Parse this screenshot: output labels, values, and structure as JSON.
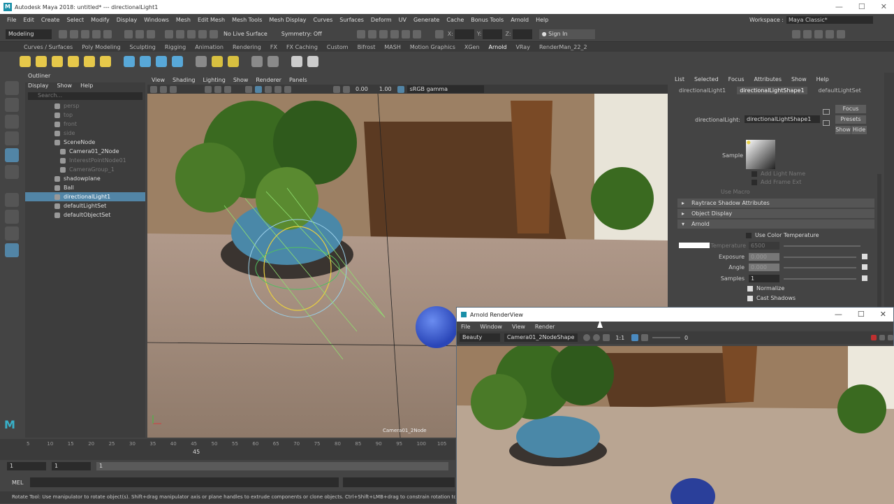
{
  "window": {
    "title": "Autodesk Maya 2018: untitled*   ---   directionalLight1",
    "logo": "M",
    "controls": [
      "—",
      "☐",
      "✕"
    ]
  },
  "menubar": {
    "items": [
      "File",
      "Edit",
      "Create",
      "Select",
      "Modify",
      "Display",
      "Windows",
      "Mesh",
      "Edit Mesh",
      "Mesh Tools",
      "Mesh Display",
      "Curves",
      "Surfaces",
      "Deform",
      "UV",
      "Generate",
      "Cache",
      "Bonus Tools",
      "Arnold",
      "Help"
    ],
    "workspace_label": "Workspace :",
    "workspace_value": "Maya Classic*"
  },
  "statusline": {
    "mode": "Modeling",
    "live_surface": "No Live Surface",
    "symmetry": "Symmetry: Off",
    "x": "X:",
    "y": "Y:",
    "z": "Z:",
    "sign_in": "Sign In"
  },
  "shelf_tabs": [
    "Curves / Surfaces",
    "Poly Modeling",
    "Sculpting",
    "Rigging",
    "Animation",
    "Rendering",
    "FX",
    "FX Caching",
    "Custom",
    "Bifrost",
    "MASH",
    "Motion Graphics",
    "XGen",
    "Arnold",
    "VRay",
    "RenderMan_22_2"
  ],
  "shelf_active": "Arnold",
  "outliner": {
    "title": "Outliner",
    "menu": [
      "Display",
      "Show",
      "Help"
    ],
    "search_placeholder": "Search...",
    "items": [
      {
        "label": "persp",
        "dim": true
      },
      {
        "label": "top",
        "dim": true
      },
      {
        "label": "front",
        "dim": true
      },
      {
        "label": "side",
        "dim": true
      },
      {
        "label": "SceneNode",
        "dim": false
      },
      {
        "label": "Camera01_2Node",
        "dim": false
      },
      {
        "label": "InterestPointNode01",
        "dim": true
      },
      {
        "label": "CameraGroup_1",
        "dim": true
      },
      {
        "label": "shadowplane",
        "dim": false
      },
      {
        "label": "Ball",
        "dim": false
      },
      {
        "label": "directionalLight1",
        "dim": false,
        "selected": true
      },
      {
        "label": "defaultLightSet",
        "dim": false
      },
      {
        "label": "defaultObjectSet",
        "dim": false
      }
    ]
  },
  "viewport": {
    "menu": [
      "View",
      "Shading",
      "Lighting",
      "Show",
      "Renderer",
      "Panels"
    ],
    "exposure": "0.00",
    "gamma": "1.00",
    "colorspace": "sRGB gamma",
    "camera_label": "Camera01_2Node"
  },
  "attribute_editor": {
    "menu": [
      "List",
      "Selected",
      "Focus",
      "Attributes",
      "Show",
      "Help"
    ],
    "tabs": [
      "directionalLight1",
      "directionalLightShape1",
      "defaultLightSet"
    ],
    "node_label": "directionalLight:",
    "node_value": "directionalLightShape1",
    "focus": "Focus",
    "presets": "Presets",
    "show": "Show",
    "hide": "Hide",
    "sample_label": "Sample",
    "faded": [
      "Add Light Name",
      "Add Frame Ext",
      "Use Macro"
    ],
    "sections": [
      "Raytrace Shadow Attributes",
      "Object Display",
      "Arnold"
    ],
    "use_color_temperature": "Use Color Temperature",
    "temperature_label": "Temperature",
    "temperature_value": "6500",
    "exposure_label": "Exposure",
    "exposure_value": "0.000",
    "angle_label": "Angle",
    "angle_value": "0.000",
    "samples_label": "Samples",
    "samples_value": "1",
    "normalize": "Normalize",
    "cast_shadows": "Cast Shadows"
  },
  "timeline": {
    "ticks": [
      "5",
      "10",
      "15",
      "20",
      "25",
      "30",
      "35",
      "40",
      "45",
      "50",
      "55",
      "60",
      "65",
      "70",
      "75",
      "80",
      "85",
      "90",
      "95",
      "100",
      "105"
    ],
    "current": "45",
    "range_start": "1",
    "range_start2": "1",
    "range_end": "1"
  },
  "cmdline": {
    "label": "MEL"
  },
  "helpline": "Rotate Tool: Use manipulator to rotate object(s). Shift+drag manipulator axis or plane handles to extrude components or clone objects. Ctrl+Shift+LMB+drag to constrain rotation to connected edges. Use D or INSERT to change the pivot position and axis orientation.",
  "renderview": {
    "title": "Arnold RenderView",
    "menu": [
      "File",
      "Window",
      "View",
      "Render"
    ],
    "aov": "Beauty",
    "camera": "Camera01_2NodeShape",
    "ratio": "1:1",
    "exposure": "0",
    "controls": [
      "—",
      "☐",
      "✕"
    ]
  }
}
